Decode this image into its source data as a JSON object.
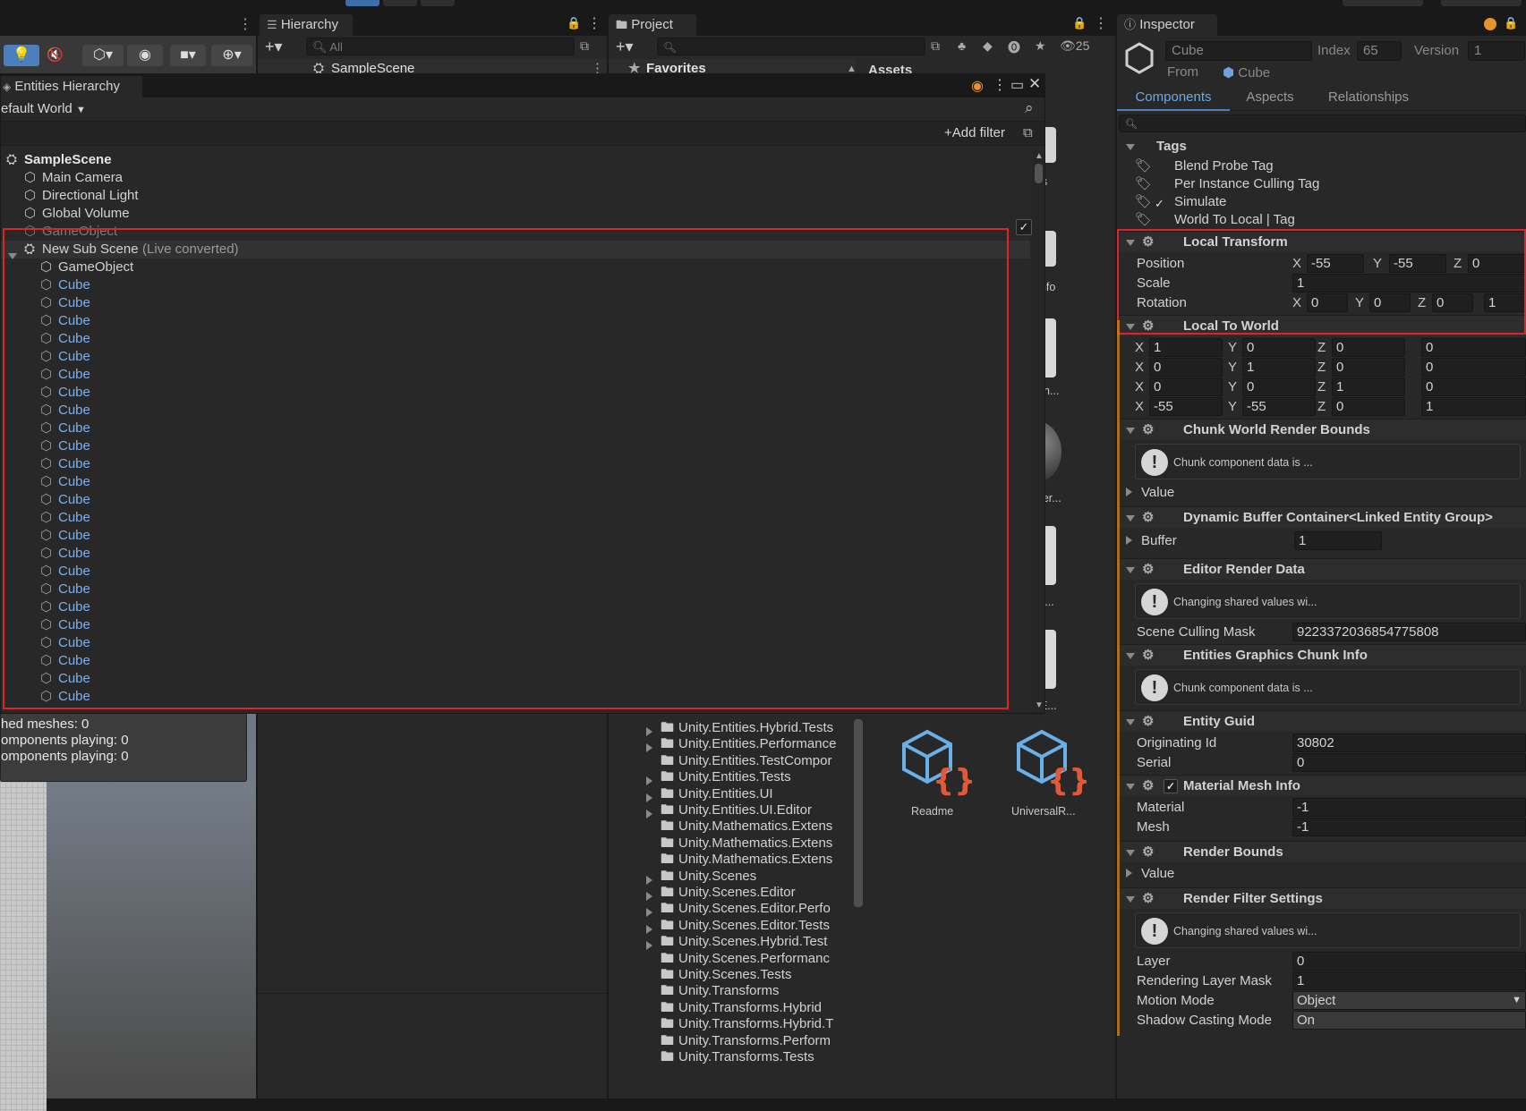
{
  "colors": {
    "accent": "#4c7fbb",
    "highlight": "#e0232a",
    "link": "#6fa0e0",
    "prefab": "#7bb0f0"
  },
  "hierarchy": {
    "tab": "Hierarchy",
    "search_placeholder": "All",
    "scene": "SampleScene"
  },
  "project": {
    "tab": "Project",
    "count": "25",
    "favorites": "Favorites",
    "assets": "Assets",
    "folders": [
      {
        "name": "Unity.Entities.Hybrid.Tests",
        "arrow": true
      },
      {
        "name": "Unity.Entities.Performance",
        "arrow": true
      },
      {
        "name": "Unity.Entities.TestCompor",
        "arrow": false
      },
      {
        "name": "Unity.Entities.Tests",
        "arrow": true
      },
      {
        "name": "Unity.Entities.UI",
        "arrow": true
      },
      {
        "name": "Unity.Entities.UI.Editor",
        "arrow": true
      },
      {
        "name": "Unity.Mathematics.Extens",
        "arrow": false
      },
      {
        "name": "Unity.Mathematics.Extens",
        "arrow": false
      },
      {
        "name": "Unity.Mathematics.Extens",
        "arrow": false
      },
      {
        "name": "Unity.Scenes",
        "arrow": true
      },
      {
        "name": "Unity.Scenes.Editor",
        "arrow": true
      },
      {
        "name": "Unity.Scenes.Editor.Perfo",
        "arrow": true
      },
      {
        "name": "Unity.Scenes.Editor.Tests",
        "arrow": true
      },
      {
        "name": "Unity.Scenes.Hybrid.Test",
        "arrow": true
      },
      {
        "name": "Unity.Scenes.Performanc",
        "arrow": false
      },
      {
        "name": "Unity.Scenes.Tests",
        "arrow": false
      },
      {
        "name": "Unity.Transforms",
        "arrow": false
      },
      {
        "name": "Unity.Transforms.Hybrid",
        "arrow": false
      },
      {
        "name": "Unity.Transforms.Hybrid.T",
        "arrow": false
      },
      {
        "name": "Unity.Transforms.Perform",
        "arrow": false
      },
      {
        "name": "Unity.Transforms.Tests",
        "arrow": false
      }
    ],
    "assets_list": [
      "nes",
      "allInfo",
      "Ren...",
      "Mater...",
      "hav...",
      "rstE...",
      "Readme",
      "UniversalR..."
    ]
  },
  "entities": {
    "title": "Entities Hierarchy",
    "world": "efault World",
    "add_filter": "Add filter",
    "rows": [
      {
        "label": "SampleScene",
        "kind": "scene"
      },
      {
        "label": "Main Camera",
        "kind": "go"
      },
      {
        "label": "Directional Light",
        "kind": "go"
      },
      {
        "label": "Global Volume",
        "kind": "go"
      },
      {
        "label": "GameObject",
        "kind": "dim"
      },
      {
        "label": "New Sub Scene",
        "kind": "subscene",
        "suffix": "(Live converted)"
      },
      {
        "label": "GameObject",
        "kind": "go2"
      },
      {
        "label": "Cube",
        "kind": "cube"
      },
      {
        "label": "Cube",
        "kind": "cube"
      },
      {
        "label": "Cube",
        "kind": "cube"
      },
      {
        "label": "Cube",
        "kind": "cube"
      },
      {
        "label": "Cube",
        "kind": "cube"
      },
      {
        "label": "Cube",
        "kind": "cube"
      },
      {
        "label": "Cube",
        "kind": "cube"
      },
      {
        "label": "Cube",
        "kind": "cube"
      },
      {
        "label": "Cube",
        "kind": "cube"
      },
      {
        "label": "Cube",
        "kind": "cube"
      },
      {
        "label": "Cube",
        "kind": "cube"
      },
      {
        "label": "Cube",
        "kind": "cube"
      },
      {
        "label": "Cube",
        "kind": "cube"
      },
      {
        "label": "Cube",
        "kind": "cube"
      },
      {
        "label": "Cube",
        "kind": "cube"
      },
      {
        "label": "Cube",
        "kind": "cube"
      },
      {
        "label": "Cube",
        "kind": "cube"
      },
      {
        "label": "Cube",
        "kind": "cube"
      },
      {
        "label": "Cube",
        "kind": "cube"
      },
      {
        "label": "Cube",
        "kind": "cube"
      },
      {
        "label": "Cube",
        "kind": "cube"
      },
      {
        "label": "Cube",
        "kind": "cube"
      },
      {
        "label": "Cube",
        "kind": "cube"
      },
      {
        "label": "Cube",
        "kind": "cube"
      }
    ]
  },
  "stats": {
    "line1": "hed meshes: 0",
    "line2": "omponents playing: 0",
    "line3": "omponents playing: 0"
  },
  "inspector": {
    "tab": "Inspector",
    "entity_name": "Cube",
    "index_label": "Index",
    "index": "65",
    "version_label": "Version",
    "version": "1",
    "from_label": "From",
    "from": "Cube",
    "tabs": [
      "Components",
      "Aspects",
      "Relationships"
    ],
    "tags_title": "Tags",
    "tags": [
      "Blend Probe Tag",
      "Per Instance Culling Tag",
      "Simulate",
      "World To Local | Tag"
    ],
    "local_transform": {
      "title": "Local Transform",
      "position_label": "Position",
      "position": [
        "-55",
        "-55",
        "0"
      ],
      "scale_label": "Scale",
      "scale": "1",
      "rotation_label": "Rotation",
      "rotation": [
        "0",
        "0",
        "0",
        "1"
      ]
    },
    "local_to_world": {
      "title": "Local To World",
      "rows": [
        [
          "1",
          "0",
          "0",
          "0"
        ],
        [
          "0",
          "1",
          "0",
          "0"
        ],
        [
          "0",
          "0",
          "1",
          "0"
        ],
        [
          "-55",
          "-55",
          "0",
          "1"
        ]
      ]
    },
    "chunk_world_render_bounds": {
      "title": "Chunk World Render Bounds",
      "warning": "Chunk component data is ...",
      "value_label": "Value"
    },
    "dynamic_buffer": {
      "title": "Dynamic Buffer Container<Linked Entity Group>",
      "buffer_label": "Buffer",
      "buffer": "1"
    },
    "editor_render_data": {
      "title": "Editor Render Data",
      "warning": "Changing shared values wi...",
      "mask_label": "Scene Culling Mask",
      "mask": "9223372036854775808"
    },
    "entities_graphics_chunk_info": {
      "title": "Entities Graphics Chunk Info",
      "warning": "Chunk component data is ..."
    },
    "entity_guid": {
      "title": "Entity Guid",
      "originating_label": "Originating Id",
      "originating": "30802",
      "serial_label": "Serial",
      "serial": "0"
    },
    "material_mesh_info": {
      "title": "Material Mesh Info",
      "material_label": "Material",
      "material": "-1",
      "mesh_label": "Mesh",
      "mesh": "-1"
    },
    "render_bounds": {
      "title": "Render Bounds",
      "value_label": "Value"
    },
    "render_filter_settings": {
      "title": "Render Filter Settings",
      "warning": "Changing shared values wi...",
      "layer_label": "Layer",
      "layer": "0",
      "rlm_label": "Rendering Layer Mask",
      "rlm": "1",
      "motion_label": "Motion Mode",
      "motion": "Object",
      "shadow_label": "Shadow Casting Mode",
      "shadow": "On"
    }
  }
}
